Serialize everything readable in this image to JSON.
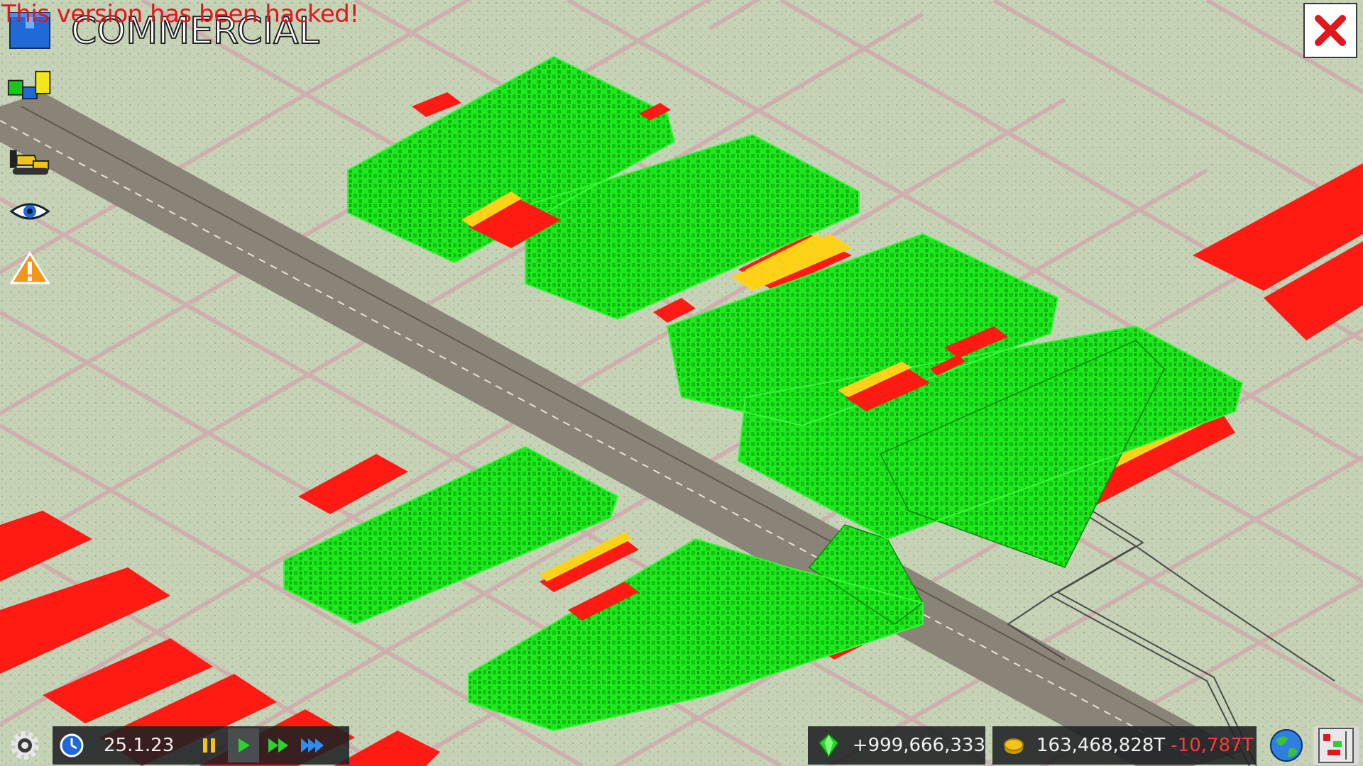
{
  "banner": {
    "text": "This version has been hacked!"
  },
  "mode": {
    "title": "COMMERCIAL"
  },
  "toolbar_left": [
    {
      "id": "zone-tool",
      "icon": "zone-tool-icon"
    },
    {
      "id": "zones-overview",
      "icon": "zones-icon"
    },
    {
      "id": "bulldoze",
      "icon": "bulldozer-icon"
    },
    {
      "id": "view",
      "icon": "eye-icon"
    },
    {
      "id": "warnings",
      "icon": "warning-icon"
    }
  ],
  "close": {
    "icon": "close-icon"
  },
  "bottom": {
    "date": "25.1.23",
    "diamonds": "+999,666,333",
    "money": "163,468,828T",
    "money_change": "-10,787T"
  },
  "colors": {
    "zone_green": "#17e317",
    "zone_red": "#ff1a14",
    "zone_yellow": "#ffd21a",
    "grass": "#c7d3b9",
    "road": "#c9a5a5",
    "accent_red": "#e3161b"
  }
}
